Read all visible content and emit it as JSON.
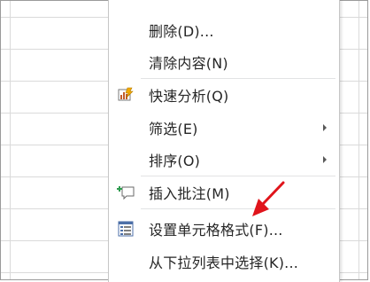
{
  "menu": {
    "items": [
      {
        "label": "删除(D)...",
        "icon": "",
        "submenu": false
      },
      {
        "label": "清除内容(N)",
        "icon": "",
        "submenu": false
      },
      {
        "label": "快速分析(Q)",
        "icon": "quick-analysis-icon",
        "submenu": false
      },
      {
        "label": "筛选(E)",
        "icon": "",
        "submenu": true
      },
      {
        "label": "排序(O)",
        "icon": "",
        "submenu": true
      },
      {
        "label": "插入批注(M)",
        "icon": "insert-comment-icon",
        "submenu": false
      },
      {
        "label": "设置单元格格式(F)...",
        "icon": "format-cells-icon",
        "submenu": false
      },
      {
        "label": "从下拉列表中选择(K)...",
        "icon": "",
        "submenu": false
      }
    ]
  },
  "annotation": {
    "color": "#e0141b"
  },
  "colors": {
    "grid": "#dadada",
    "text": "#262626",
    "separator": "#e2e3e4"
  }
}
